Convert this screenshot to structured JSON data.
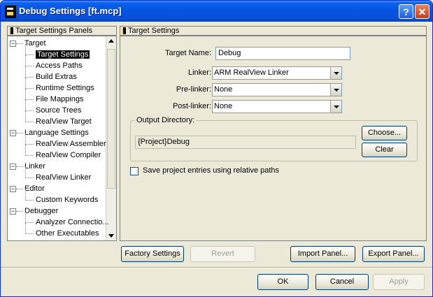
{
  "window": {
    "title": "Debug Settings [ft.mcp]",
    "help_label": "?",
    "close_label": "✕"
  },
  "left_panel": {
    "header": "Target Settings Panels",
    "tree": [
      {
        "label": "Target",
        "level": 0,
        "expanded": true
      },
      {
        "label": "Target Settings",
        "level": 1,
        "selected": true
      },
      {
        "label": "Access Paths",
        "level": 1
      },
      {
        "label": "Build Extras",
        "level": 1
      },
      {
        "label": "Runtime Settings",
        "level": 1
      },
      {
        "label": "File Mappings",
        "level": 1
      },
      {
        "label": "Source Trees",
        "level": 1
      },
      {
        "label": "RealView Target",
        "level": 1
      },
      {
        "label": "Language Settings",
        "level": 0,
        "expanded": true
      },
      {
        "label": "RealView Assembler",
        "level": 1
      },
      {
        "label": "RealView Compiler",
        "level": 1
      },
      {
        "label": "Linker",
        "level": 0,
        "expanded": true
      },
      {
        "label": "RealView Linker",
        "level": 1
      },
      {
        "label": "Editor",
        "level": 0,
        "expanded": true
      },
      {
        "label": "Custom Keywords",
        "level": 1
      },
      {
        "label": "Debugger",
        "level": 0,
        "expanded": true
      },
      {
        "label": "Analyzer Connectio...",
        "level": 1
      },
      {
        "label": "Other Executables",
        "level": 1
      }
    ]
  },
  "right_panel": {
    "header": "Target Settings",
    "target_name_label": "Target Name:",
    "target_name_value": "Debug",
    "linker_label": "Linker:",
    "linker_value": "ARM RealView Linker",
    "prelinker_label": "Pre-linker:",
    "prelinker_value": "None",
    "postlinker_label": "Post-linker:",
    "postlinker_value": "None",
    "output_dir_label": "Output Directory:",
    "output_dir_value": "{Project}Debug",
    "choose_label": "Choose...",
    "clear_label": "Clear",
    "relative_paths_label": "Save project entries using relative paths"
  },
  "panel_buttons": {
    "factory_settings": "Factory Settings",
    "revert": "Revert",
    "import_panel": "Import Panel...",
    "export_panel": "Export Panel..."
  },
  "dialog_buttons": {
    "ok": "OK",
    "cancel": "Cancel",
    "apply": "Apply"
  }
}
